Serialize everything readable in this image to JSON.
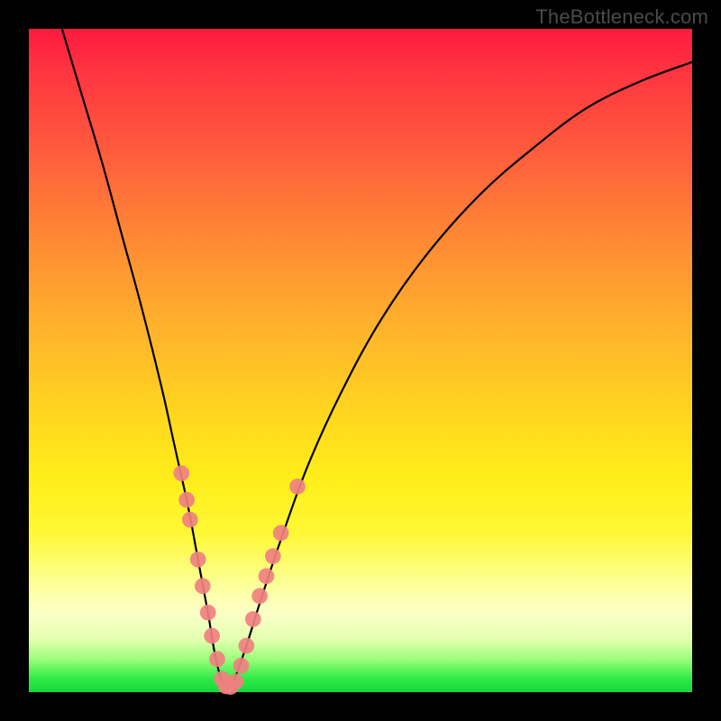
{
  "watermark": "TheBottleneck.com",
  "chart_data": {
    "type": "line",
    "title": "",
    "xlabel": "",
    "ylabel": "",
    "xlim": [
      0,
      100
    ],
    "ylim": [
      0,
      100
    ],
    "grid": false,
    "legend": false,
    "annotations": [],
    "series": [
      {
        "name": "bottleneck-curve",
        "color": "#000000",
        "x": [
          5,
          8,
          11,
          14,
          17,
          20,
          22,
          24,
          25.5,
          27,
          28,
          29,
          30,
          31,
          32.8,
          35,
          38,
          42,
          47,
          53,
          60,
          68,
          76,
          84,
          92,
          100
        ],
        "y": [
          100,
          90,
          80,
          69,
          58,
          46,
          37,
          28,
          20,
          12,
          6,
          2,
          0.8,
          2,
          7,
          14,
          23,
          34,
          45,
          56,
          66,
          75,
          82,
          88,
          92,
          95
        ]
      }
    ],
    "markers": {
      "name": "highlight-points",
      "color": "#f08080",
      "points": [
        {
          "x": 23.0,
          "y": 33.0,
          "r": 1.2
        },
        {
          "x": 23.8,
          "y": 29.0,
          "r": 1.2
        },
        {
          "x": 24.3,
          "y": 26.0,
          "r": 1.2
        },
        {
          "x": 25.5,
          "y": 20.0,
          "r": 1.2
        },
        {
          "x": 26.2,
          "y": 16.0,
          "r": 1.2
        },
        {
          "x": 27.0,
          "y": 12.0,
          "r": 1.2
        },
        {
          "x": 27.6,
          "y": 8.5,
          "r": 1.2
        },
        {
          "x": 28.4,
          "y": 5.0,
          "r": 1.2
        },
        {
          "x": 29.1,
          "y": 2.0,
          "r": 1.2
        },
        {
          "x": 29.7,
          "y": 0.9,
          "r": 1.2
        },
        {
          "x": 30.4,
          "y": 0.8,
          "r": 1.2
        },
        {
          "x": 31.2,
          "y": 1.6,
          "r": 1.2
        },
        {
          "x": 32.0,
          "y": 4.0,
          "r": 1.2
        },
        {
          "x": 32.8,
          "y": 7.0,
          "r": 1.2
        },
        {
          "x": 33.8,
          "y": 11.0,
          "r": 1.2
        },
        {
          "x": 34.8,
          "y": 14.5,
          "r": 1.2
        },
        {
          "x": 35.8,
          "y": 17.5,
          "r": 1.2
        },
        {
          "x": 36.8,
          "y": 20.5,
          "r": 1.2
        },
        {
          "x": 38.0,
          "y": 24.0,
          "r": 1.2
        },
        {
          "x": 40.5,
          "y": 31.0,
          "r": 1.2
        }
      ]
    }
  }
}
